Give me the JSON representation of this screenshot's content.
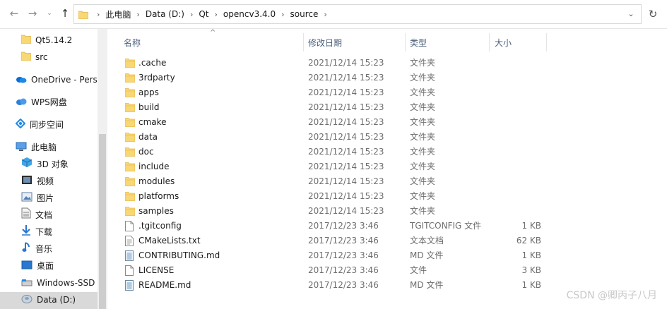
{
  "address": {
    "crumbs": [
      "此电脑",
      "Data (D:)",
      "Qt",
      "opencv3.4.0",
      "source"
    ]
  },
  "sidebar": {
    "items": [
      {
        "label": "Qt5.14.2",
        "icon": "folder-icon"
      },
      {
        "label": "src",
        "icon": "folder-icon"
      },
      {
        "label": "OneDrive - Pers",
        "icon": "onedrive-icon"
      },
      {
        "label": "WPS网盘",
        "icon": "wps-cloud-icon"
      },
      {
        "label": "同步空间",
        "icon": "sync-space-icon"
      },
      {
        "label": "此电脑",
        "icon": "this-pc-icon"
      },
      {
        "label": "3D 对象",
        "icon": "3d-objects-icon"
      },
      {
        "label": "视频",
        "icon": "videos-icon"
      },
      {
        "label": "图片",
        "icon": "pictures-icon"
      },
      {
        "label": "文档",
        "icon": "documents-icon"
      },
      {
        "label": "下载",
        "icon": "downloads-icon"
      },
      {
        "label": "音乐",
        "icon": "music-icon"
      },
      {
        "label": "桌面",
        "icon": "desktop-icon"
      },
      {
        "label": "Windows-SSD",
        "icon": "drive-icon"
      },
      {
        "label": "Data (D:)",
        "icon": "data-drive-icon"
      }
    ]
  },
  "columns": {
    "name": "名称",
    "date": "修改日期",
    "type": "类型",
    "size": "大小"
  },
  "files": [
    {
      "name": ".cache",
      "date": "2021/12/14 15:23",
      "type": "文件夹",
      "size": "",
      "kind": "folder"
    },
    {
      "name": "3rdparty",
      "date": "2021/12/14 15:23",
      "type": "文件夹",
      "size": "",
      "kind": "folder"
    },
    {
      "name": "apps",
      "date": "2021/12/14 15:23",
      "type": "文件夹",
      "size": "",
      "kind": "folder"
    },
    {
      "name": "build",
      "date": "2021/12/14 15:23",
      "type": "文件夹",
      "size": "",
      "kind": "folder"
    },
    {
      "name": "cmake",
      "date": "2021/12/14 15:23",
      "type": "文件夹",
      "size": "",
      "kind": "folder"
    },
    {
      "name": "data",
      "date": "2021/12/14 15:23",
      "type": "文件夹",
      "size": "",
      "kind": "folder"
    },
    {
      "name": "doc",
      "date": "2021/12/14 15:23",
      "type": "文件夹",
      "size": "",
      "kind": "folder"
    },
    {
      "name": "include",
      "date": "2021/12/14 15:23",
      "type": "文件夹",
      "size": "",
      "kind": "folder"
    },
    {
      "name": "modules",
      "date": "2021/12/14 15:23",
      "type": "文件夹",
      "size": "",
      "kind": "folder"
    },
    {
      "name": "platforms",
      "date": "2021/12/14 15:23",
      "type": "文件夹",
      "size": "",
      "kind": "folder"
    },
    {
      "name": "samples",
      "date": "2021/12/14 15:23",
      "type": "文件夹",
      "size": "",
      "kind": "folder"
    },
    {
      "name": ".tgitconfig",
      "date": "2017/12/23 3:46",
      "type": "TGITCONFIG 文件",
      "size": "1 KB",
      "kind": "file"
    },
    {
      "name": "CMakeLists.txt",
      "date": "2017/12/23 3:46",
      "type": "文本文档",
      "size": "62 KB",
      "kind": "text"
    },
    {
      "name": "CONTRIBUTING.md",
      "date": "2017/12/23 3:46",
      "type": "MD 文件",
      "size": "1 KB",
      "kind": "md"
    },
    {
      "name": "LICENSE",
      "date": "2017/12/23 3:46",
      "type": "文件",
      "size": "3 KB",
      "kind": "file"
    },
    {
      "name": "README.md",
      "date": "2017/12/23 3:46",
      "type": "MD 文件",
      "size": "1 KB",
      "kind": "md"
    }
  ],
  "watermark": "CSDN @卿丙子八月",
  "colors": {
    "folder": "#f8d775",
    "folder_dark": "#e8b94a",
    "selected": "#d9d9d9",
    "header_text": "#4c607a"
  }
}
